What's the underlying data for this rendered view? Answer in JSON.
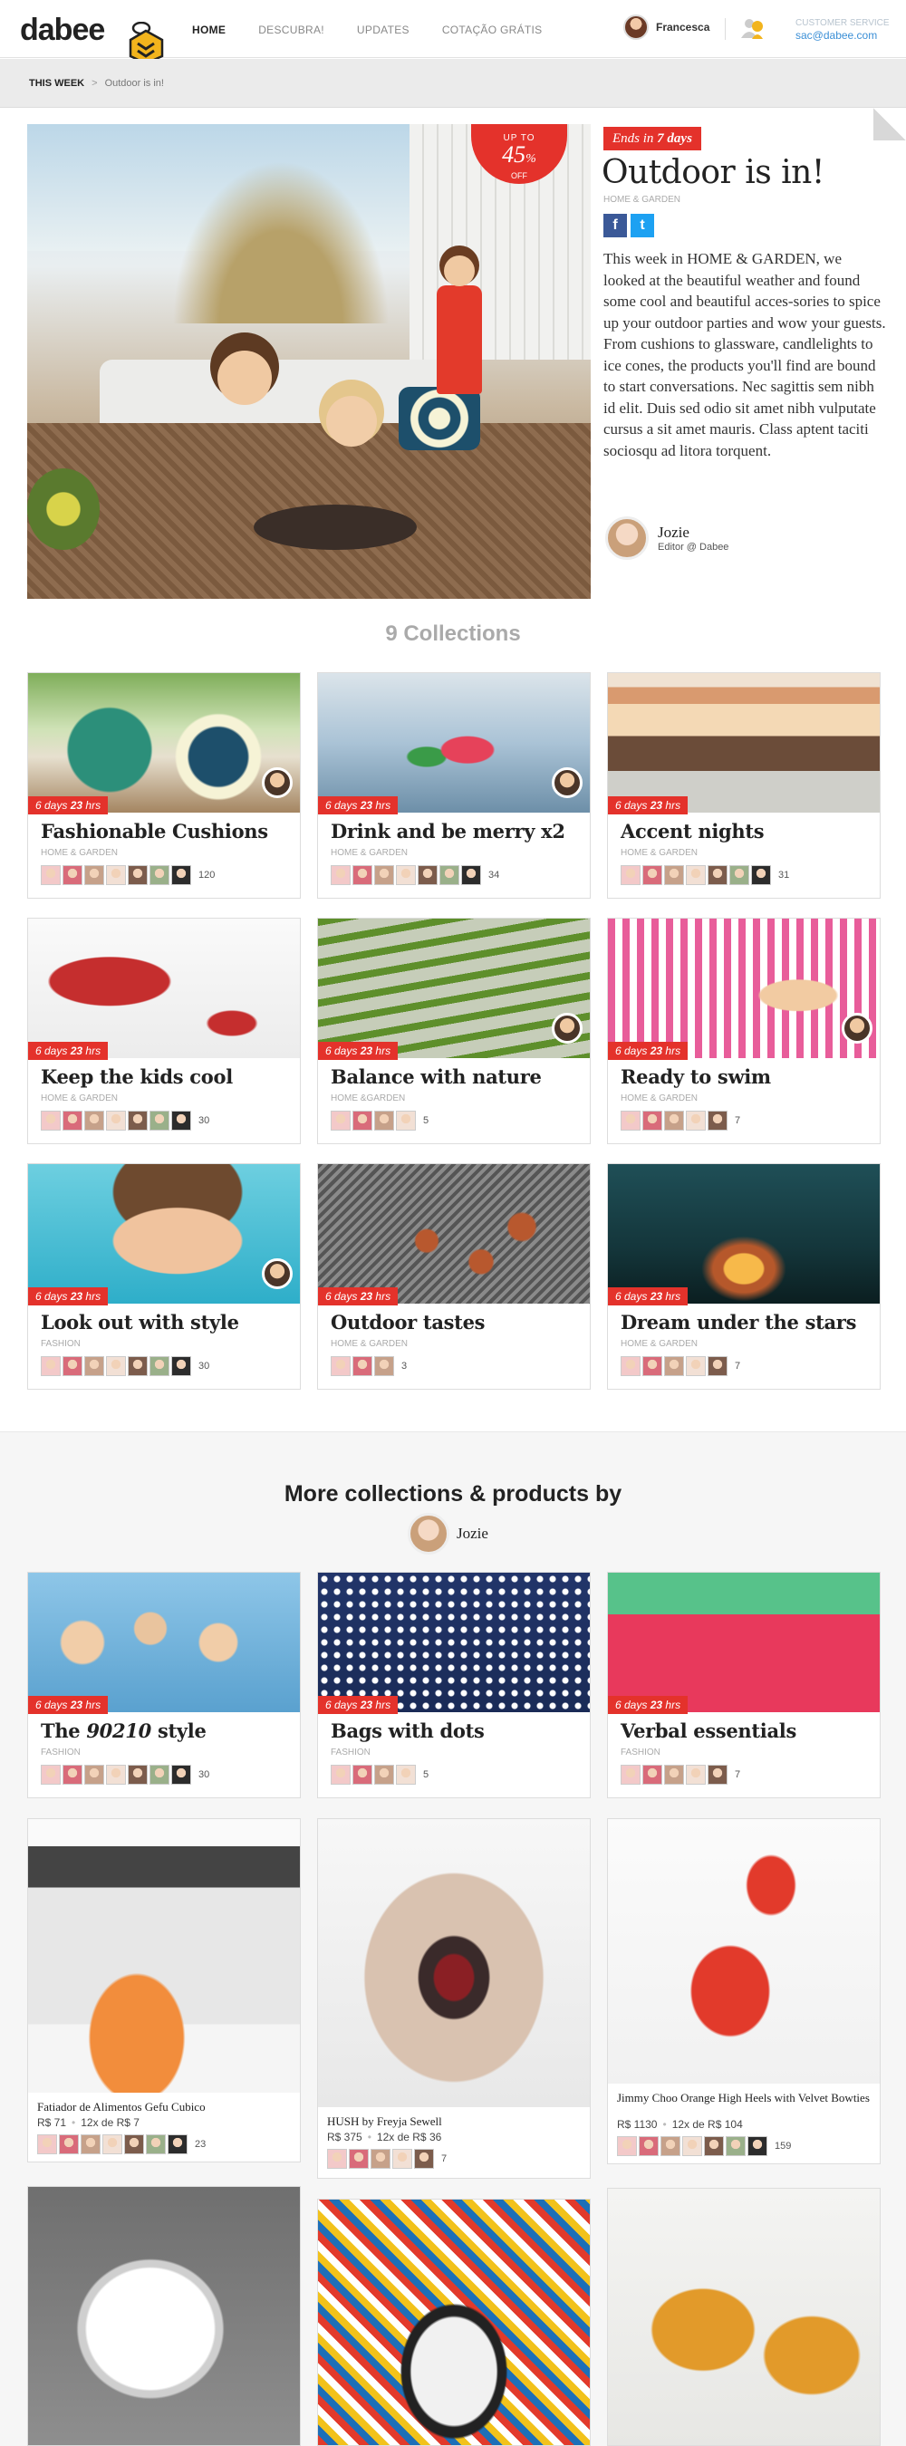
{
  "header": {
    "logo": "dabee",
    "nav": [
      "HOME",
      "DESCUBRA!",
      "UPDATES",
      "COTAÇÃO GRÁTIS"
    ],
    "user_name": "Francesca",
    "customer_service_label": "CUSTOMER SERVICE",
    "customer_service_email": "sac@dabee.com"
  },
  "breadcrumb": {
    "section": "THIS WEEK",
    "separator": ">",
    "current": "Outdoor is in!"
  },
  "hero": {
    "badge_up_to": "UP TO",
    "badge_percent": "45",
    "badge_percent_sign": "%",
    "badge_off": "OFF",
    "ends_prefix": "Ends in",
    "ends_value": "7 days",
    "title": "Outdoor is in!",
    "category": "HOME & GARDEN",
    "description": "This week in HOME & GARDEN, we looked at the beautiful weather and found some cool and beautiful acces-sories to spice up your outdoor parties and wow your guests. From cushions to glassware, candlelights to ice cones, the products you'll find are bound to start conversations.  Nec sagittis sem nibh id elit. Duis sed odio sit amet nibh vulputate cursus a sit amet mauris. Class aptent taciti sociosqu ad litora torquent.",
    "editor_name": "Jozie",
    "editor_role": "Editor @ Dabee"
  },
  "collections_title": "9 Collections",
  "collections": [
    {
      "days": "6 days",
      "hrs": "23",
      "hrs_label": "hrs",
      "title": "Fashionable Cushions",
      "category": "HOME & GARDEN",
      "count": "120",
      "faces": 7,
      "img": "cushions"
    },
    {
      "days": "6 days",
      "hrs": "23",
      "hrs_label": "hrs",
      "title": "Drink and be merry x2",
      "category": "HOME & GARDEN",
      "count": "34",
      "faces": 7,
      "img": "drink"
    },
    {
      "days": "6 days",
      "hrs": "23",
      "hrs_label": "hrs",
      "title": "Accent nights",
      "category": "HOME & GARDEN",
      "count": "31",
      "faces": 7,
      "img": "accent"
    },
    {
      "days": "6 days",
      "hrs": "23",
      "hrs_label": "hrs",
      "title": "Keep the kids cool",
      "category": "HOME & GARDEN",
      "count": "30",
      "faces": 7,
      "img": "kids"
    },
    {
      "days": "6 days",
      "hrs": "23",
      "hrs_label": "hrs",
      "title": "Balance with nature",
      "category": "HOME &GARDEN",
      "count": "5",
      "faces": 4,
      "img": "nature"
    },
    {
      "days": "6 days",
      "hrs": "23",
      "hrs_label": "hrs",
      "title": "Ready to swim",
      "category": "HOME & GARDEN",
      "count": "7",
      "faces": 5,
      "img": "swim"
    },
    {
      "days": "6 days",
      "hrs": "23",
      "hrs_label": "hrs",
      "title": "Look out with style",
      "category": "FASHION",
      "count": "30",
      "faces": 7,
      "img": "style"
    },
    {
      "days": "6 days",
      "hrs": "23",
      "hrs_label": "hrs",
      "title": "Outdoor tastes",
      "category": "HOME & GARDEN",
      "count": "3",
      "faces": 3,
      "img": "tastes"
    },
    {
      "days": "6 days",
      "hrs": "23",
      "hrs_label": "hrs",
      "title": "Dream under the stars",
      "category": "HOME & GARDEN",
      "count": "7",
      "faces": 5,
      "img": "stars"
    }
  ],
  "more": {
    "title": "More collections & products by",
    "author": "Jozie",
    "collections": [
      {
        "days": "6 days",
        "hrs": "23",
        "hrs_label": "hrs",
        "title_prefix": "The ",
        "title_em": "90210",
        "title_suffix": " style",
        "category": "FASHION",
        "count": "30",
        "faces": 7,
        "img": "90210"
      },
      {
        "days": "6 days",
        "hrs": "23",
        "hrs_label": "hrs",
        "title_prefix": "Bags with dots",
        "title_em": "",
        "title_suffix": "",
        "category": "FASHION",
        "count": "5",
        "faces": 4,
        "img": "dots"
      },
      {
        "days": "6 days",
        "hrs": "23",
        "hrs_label": "hrs",
        "title_prefix": "Verbal essentials",
        "title_em": "",
        "title_suffix": "",
        "category": "FASHION",
        "count": "7",
        "faces": 5,
        "img": "verbal"
      }
    ],
    "products": [
      {
        "name": "Fatiador de Alimentos Gefu Cubico",
        "price": "R$ 71",
        "installments": "12x de R$ 7",
        "count": "23",
        "faces": 7,
        "img": "slicer"
      },
      {
        "name": "HUSH by Freyja Sewell",
        "price": "R$ 375",
        "installments": "12x de R$ 36",
        "count": "7",
        "faces": 5,
        "img": "hush"
      },
      {
        "name": "Jimmy Choo Orange High Heels with Velvet Bowties",
        "price": "R$ 1130",
        "installments": "12x de R$ 104",
        "count": "159",
        "faces": 7,
        "img": "heels"
      }
    ]
  },
  "colors": {
    "accent_red": "#e4322b",
    "link_blue": "#3b8fd6",
    "facebook": "#3b5998",
    "twitter": "#1da1f2"
  }
}
